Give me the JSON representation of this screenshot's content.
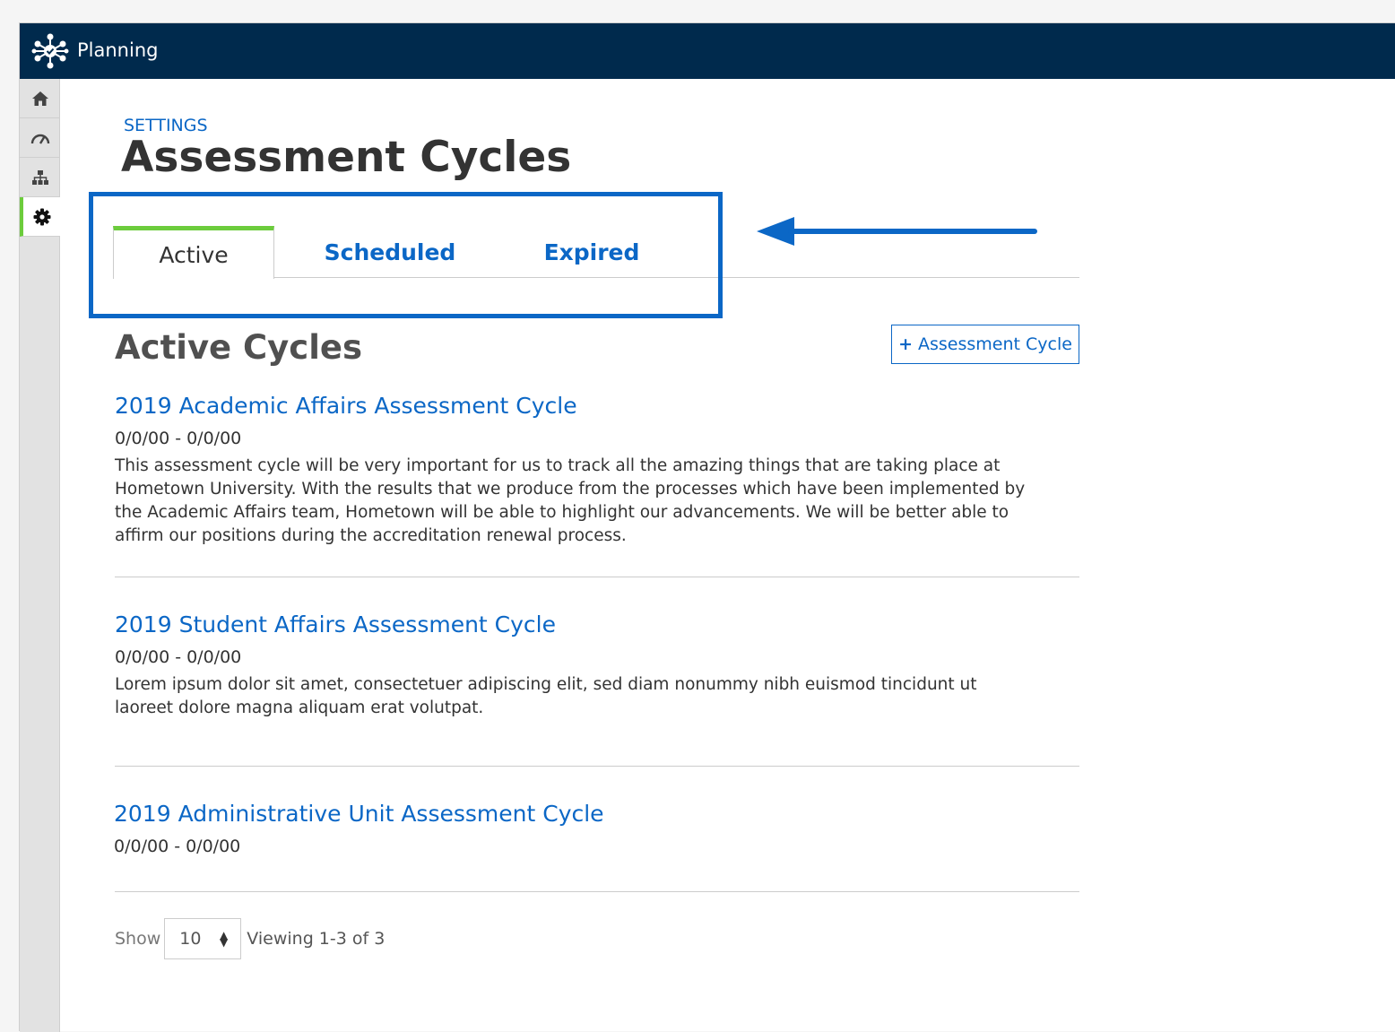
{
  "app": {
    "title": "Planning"
  },
  "sidebar": {
    "items": [
      {
        "icon": "home-icon"
      },
      {
        "icon": "dashboard-icon"
      },
      {
        "icon": "org-chart-icon"
      },
      {
        "icon": "gear-icon",
        "active": true
      }
    ]
  },
  "header": {
    "breadcrumb": "SETTINGS",
    "title": "Assessment Cycles"
  },
  "tabs": [
    {
      "label": "Active",
      "active": true
    },
    {
      "label": "Scheduled",
      "active": false
    },
    {
      "label": "Expired",
      "active": false
    }
  ],
  "section": {
    "title": "Active Cycles",
    "add_button_label": "Assessment Cycle",
    "add_button_icon": "plus-icon"
  },
  "cycles": [
    {
      "title": "2019 Academic Affairs Assessment Cycle",
      "dates": "0/0/00 - 0/0/00",
      "description": "This assessment cycle will be very important for us to track all the amazing things that are taking place at Hometown University. With the results that we produce from the processes which have been implemented by the Academic Affairs team, Hometown will be able to highlight our advancements. We will be better able to affirm our positions during the accreditation renewal process."
    },
    {
      "title": "2019 Student Affairs Assessment Cycle",
      "dates": "0/0/00 - 0/0/00",
      "description": "Lorem ipsum dolor sit amet, consectetuer adipiscing elit, sed diam nonummy nibh euismod tincidunt ut laoreet dolore magna aliquam erat volutpat."
    },
    {
      "title": "2019 Administrative Unit Assessment Cycle",
      "dates": "0/0/00 - 0/0/00",
      "description": ""
    }
  ],
  "pager": {
    "show_label": "Show",
    "page_size": "10",
    "viewing": "Viewing 1-3 of 3"
  },
  "colors": {
    "topbar": "#002a4d",
    "accent_blue": "#0b67c6",
    "active_green": "#6ccc3c"
  }
}
